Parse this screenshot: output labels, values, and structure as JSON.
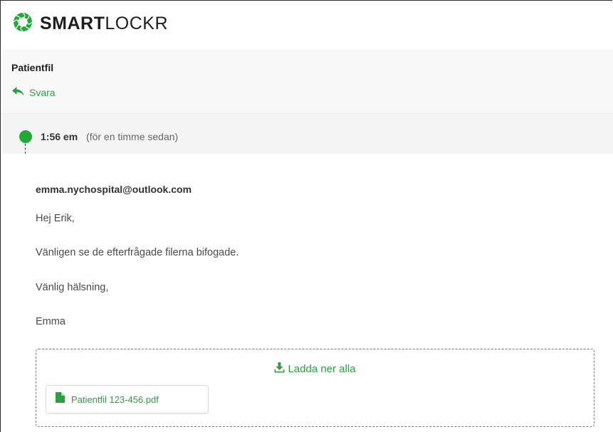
{
  "brand": {
    "name_bold": "SMART",
    "name_light": "LOCKR",
    "logo_icon": "smartlockr-ring-icon",
    "accent_color": "#22a836"
  },
  "message_header": {
    "subject": "Patientfil",
    "reply_label": "Svara",
    "reply_icon": "reply-arrow-icon"
  },
  "message": {
    "time": "1:56 em",
    "relative_time": "(för en timme sedan)",
    "sender": "emma.nychospital@outlook.com",
    "body_lines": [
      "Hej Erik,",
      "Vänligen se de efterfrågade filerna bifogade.",
      "Vänlig hälsning,",
      "Emma"
    ]
  },
  "attachments": {
    "download_all_label": "Ladda ner alla",
    "download_icon": "download-icon",
    "files": [
      {
        "name": "Patientfil 123-456.pdf",
        "icon": "file-icon"
      }
    ]
  }
}
